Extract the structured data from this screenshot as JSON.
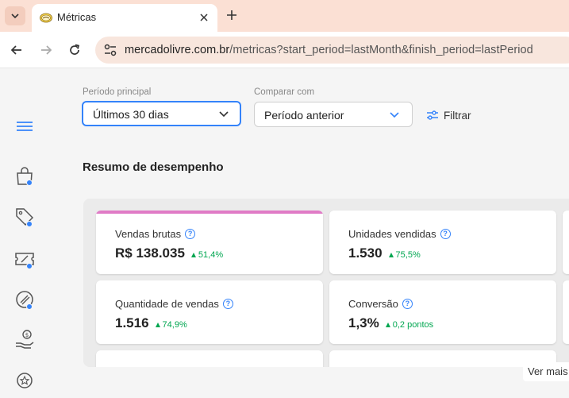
{
  "browser": {
    "tab_title": "Métricas",
    "url_host": "mercadolivre.com.br",
    "url_path": "/metricas?start_period=lastMonth&finish_period=lastPeriod"
  },
  "filters": {
    "main_label": "Período principal",
    "main_value": "Últimos 30 dias",
    "compare_label": "Comparar com",
    "compare_value": "Período anterior",
    "filter_button": "Filtrar"
  },
  "summary": {
    "title": "Resumo de desempenho",
    "cards": [
      {
        "label": "Vendas brutas",
        "value": "R$ 138.035",
        "delta": "51,4%"
      },
      {
        "label": "Unidades vendidas",
        "value": "1.530",
        "delta": "75,5%"
      },
      {
        "label": "Quantidade de vendas",
        "value": "1.516",
        "delta": "74,9%"
      },
      {
        "label": "Conversão",
        "value": "1,3%",
        "delta": "0,2 pontos"
      }
    ],
    "see_more": "Ver mais"
  },
  "icons": {
    "sidebar": [
      "menu-icon",
      "shopping-bag-icon",
      "price-tag-icon",
      "coupon-icon",
      "megaphone-icon",
      "money-hand-icon",
      "star-badge-icon"
    ]
  },
  "colors": {
    "accent_blue": "#3483fa",
    "positive_green": "#00a650",
    "highlight_pink": "#e07bc6"
  }
}
